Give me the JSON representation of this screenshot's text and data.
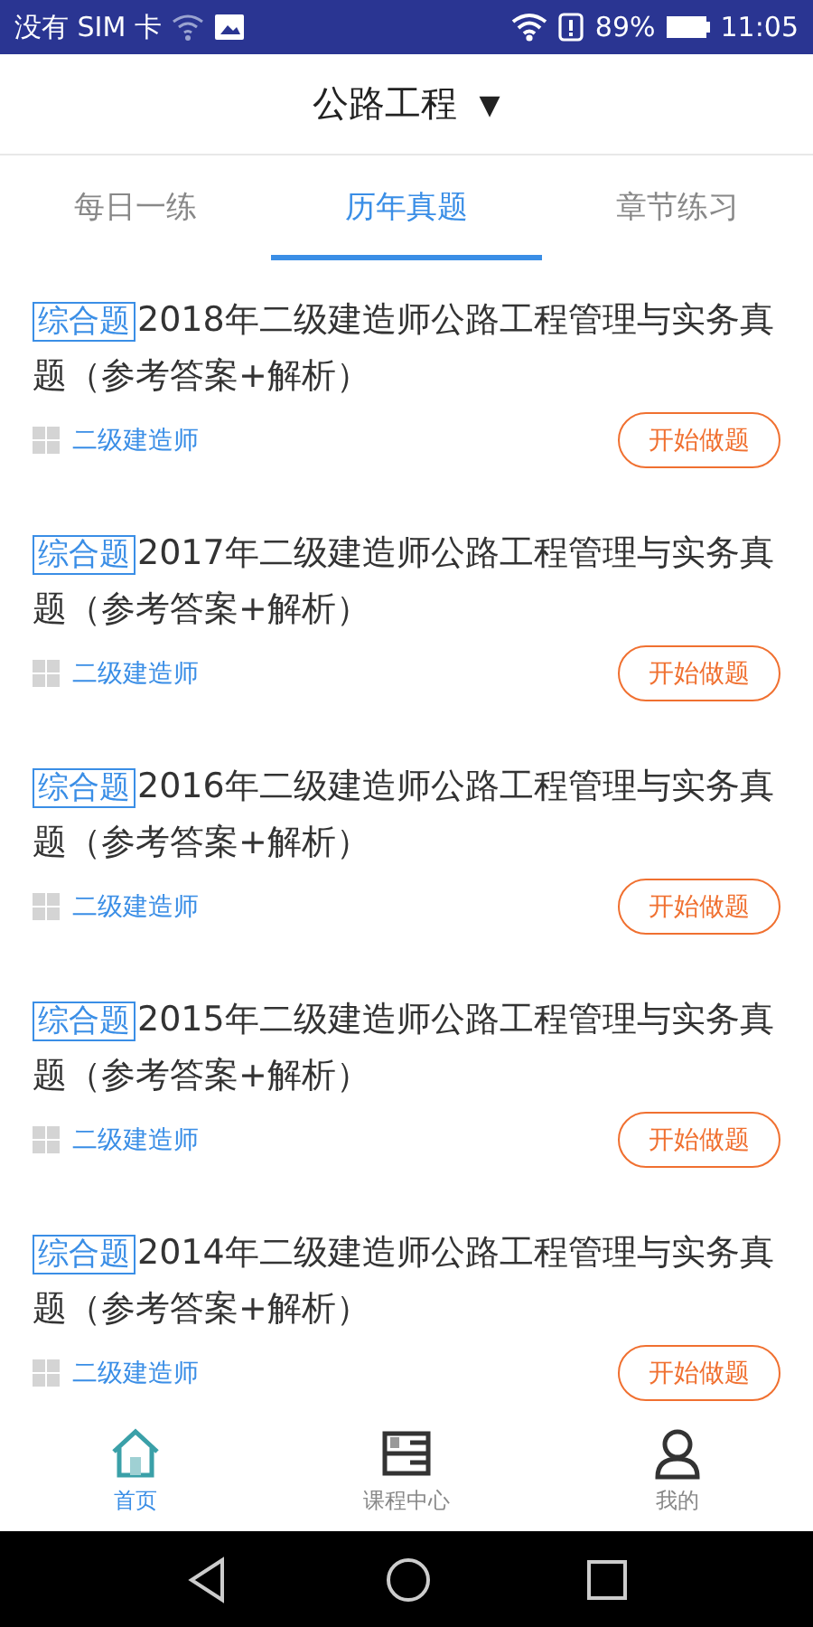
{
  "status_bar": {
    "carrier": "没有 SIM 卡",
    "battery": "89%",
    "time": "11:05"
  },
  "header": {
    "title": "公路工程",
    "dropdown": "▼"
  },
  "tabs": [
    {
      "label": "每日一练",
      "selected": false
    },
    {
      "label": "历年真题",
      "selected": true
    },
    {
      "label": "章节练习",
      "selected": false
    }
  ],
  "papers": [
    {
      "tag": "综合题",
      "title": "2018年二级建造师公路工程管理与实务真题（参考答案+解析）",
      "category": "二级建造师",
      "action": "开始做题"
    },
    {
      "tag": "综合题",
      "title": "2017年二级建造师公路工程管理与实务真题（参考答案+解析）",
      "category": "二级建造师",
      "action": "开始做题"
    },
    {
      "tag": "综合题",
      "title": "2016年二级建造师公路工程管理与实务真题（参考答案+解析）",
      "category": "二级建造师",
      "action": "开始做题"
    },
    {
      "tag": "综合题",
      "title": "2015年二级建造师公路工程管理与实务真题（参考答案+解析）",
      "category": "二级建造师",
      "action": "开始做题"
    },
    {
      "tag": "综合题",
      "title": "2014年二级建造师公路工程管理与实务真题（参考答案+解析）",
      "category": "二级建造师",
      "action": "开始做题"
    }
  ],
  "bottom_nav": [
    {
      "kind": "home",
      "label": "首页",
      "selected": true
    },
    {
      "kind": "courses",
      "label": "课程中心",
      "selected": false
    },
    {
      "kind": "profile",
      "label": "我的",
      "selected": false
    }
  ]
}
